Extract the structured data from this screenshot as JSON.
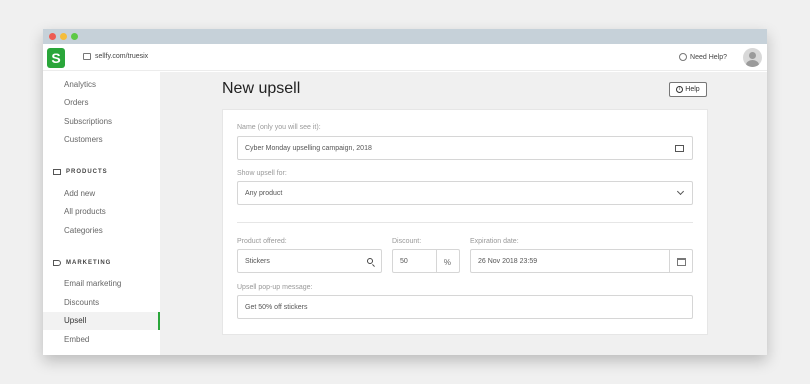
{
  "topbar": {
    "logo_letter": "S",
    "store_url": "sellfy.com/truesix",
    "need_help": "Need Help?"
  },
  "sidebar": {
    "items_top": [
      {
        "label": "Analytics"
      },
      {
        "label": "Orders"
      },
      {
        "label": "Subscriptions"
      },
      {
        "label": "Customers"
      }
    ],
    "products_section": "PRODUCTS",
    "product_items": [
      {
        "label": "Add new"
      },
      {
        "label": "All products"
      },
      {
        "label": "Categories"
      }
    ],
    "marketing_section": "MARKETING",
    "marketing_items": [
      {
        "label": "Email marketing"
      },
      {
        "label": "Discounts"
      },
      {
        "label": "Upsell"
      },
      {
        "label": "Embed"
      }
    ]
  },
  "main": {
    "title": "New upsell",
    "help_label": "Help",
    "form": {
      "name_label": "Name (only you will see it):",
      "name_value": "Cyber Monday upselling campaign, 2018",
      "show_for_label": "Show upsell for:",
      "show_for_value": "Any product",
      "product_label": "Product offered:",
      "product_value": "Stickers",
      "discount_label": "Discount:",
      "discount_value": "50",
      "discount_unit": "%",
      "expiration_label": "Expiration date:",
      "expiration_value": "26 Nov 2018 23:59",
      "message_label": "Upsell pop-up message:",
      "message_value": "Get 50% off stickers"
    }
  },
  "colors": {
    "brand_green": "#2aa63a"
  }
}
